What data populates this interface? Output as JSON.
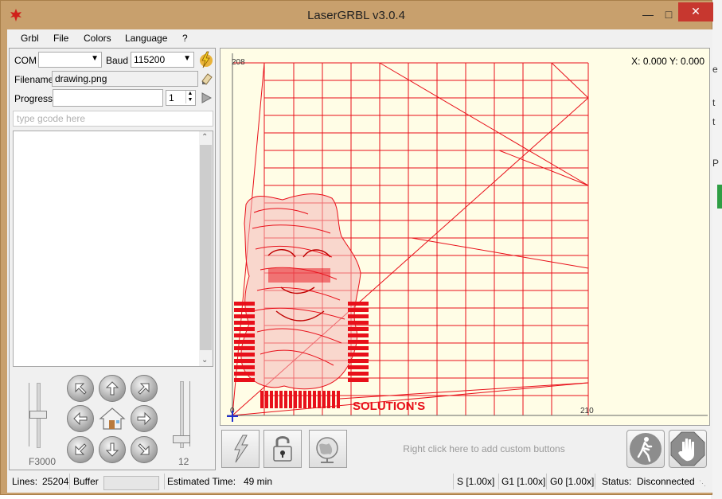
{
  "window": {
    "title": "LaserGRBL v3.0.4"
  },
  "menu": [
    "Grbl",
    "File",
    "Colors",
    "Language",
    "?"
  ],
  "connection": {
    "com_label": "COM",
    "com_value": "",
    "baud_label": "Baud",
    "baud_value": "115200"
  },
  "file": {
    "filename_label": "Filename",
    "filename_value": "drawing.png",
    "progress_label": "Progress",
    "progress_percent": 0,
    "copies_value": "1"
  },
  "gcode_input": {
    "placeholder": "type gcode here"
  },
  "jog": {
    "feed_label": "F3000",
    "step_label": "12"
  },
  "canvas": {
    "coords": "X: 0.000 Y: 0.000",
    "y_max_label": "208",
    "x_max_label": "210",
    "origin_label": "0",
    "engrave_text": "SOLUTION'S"
  },
  "bottom": {
    "custom_hint": "Right click here to add custom buttons"
  },
  "status": {
    "lines_label": "Lines:",
    "lines_value": "25204",
    "buffer_label": "Buffer",
    "time_label": "Estimated Time:",
    "time_value": "49 min",
    "s_override": "S [1.00x]",
    "g1_override": "G1 [1.00x]",
    "g0_override": "G0 [1.00x]",
    "status_label": "Status:",
    "status_value": "Disconnected"
  },
  "background_window": {
    "chars": [
      "e",
      "t",
      "t",
      "P"
    ]
  },
  "colors": {
    "title_bar": "#c8a06d",
    "close_button": "#c7372f",
    "canvas_bg": "#fffde6",
    "path_red": "#e8101a"
  },
  "icons": [
    "laser-leaf-icon",
    "connect-lightning-icon",
    "open-file-icon",
    "run-play-icon",
    "jog-arrow-icons",
    "home-icon",
    "reset-icon",
    "unlock-icon",
    "globe-icon",
    "walk-icon",
    "stop-hand-icon"
  ]
}
